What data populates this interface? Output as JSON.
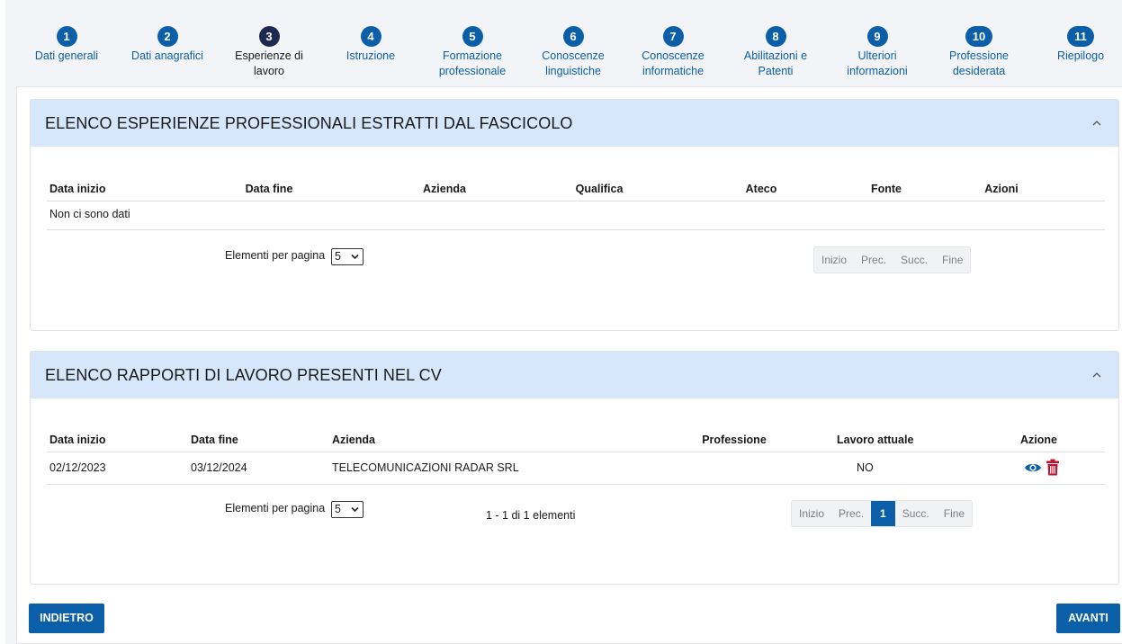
{
  "stepper": {
    "steps": [
      {
        "num": "1",
        "label": "Dati generali"
      },
      {
        "num": "2",
        "label": "Dati anagrafici"
      },
      {
        "num": "3",
        "label": "Esperienze di lavoro"
      },
      {
        "num": "4",
        "label": "Istruzione"
      },
      {
        "num": "5",
        "label": "Formazione professionale"
      },
      {
        "num": "6",
        "label": "Conoscenze linguistiche"
      },
      {
        "num": "7",
        "label": "Conoscenze informatiche"
      },
      {
        "num": "8",
        "label": "Abilitazioni e Patenti"
      },
      {
        "num": "9",
        "label": "Ulteriori informazioni"
      },
      {
        "num": "10",
        "label": "Professione desiderata"
      },
      {
        "num": "11",
        "label": "Riepilogo"
      }
    ],
    "active_step": "3"
  },
  "panel_fascicolo": {
    "title": "ELENCO ESPERIENZE PROFESSIONALI ESTRATTI DAL FASCICOLO",
    "columns": [
      "Data inizio",
      "Data fine",
      "Azienda",
      "Qualifica",
      "Ateco",
      "Fonte",
      "Azioni"
    ],
    "empty_text": "Non ci sono dati",
    "per_page_label": "Elementi per pagina",
    "per_page_value": "5",
    "pager": {
      "first": "Inizio",
      "prev": "Prec.",
      "next": "Succ.",
      "last": "Fine"
    }
  },
  "panel_cv": {
    "title": "ELENCO RAPPORTI DI LAVORO PRESENTI NEL CV",
    "columns": [
      "Data inizio",
      "Data fine",
      "Azienda",
      "Professione",
      "Lavoro attuale",
      "Azione"
    ],
    "rows": [
      {
        "data_inizio": "02/12/2023",
        "data_fine": "03/12/2024",
        "azienda": "TELECOMUNICAZIONI RADAR SRL",
        "professione": "",
        "lavoro_attuale": "NO"
      }
    ],
    "row_icons": [
      "eye-icon",
      "trash-icon"
    ],
    "per_page_label": "Elementi per pagina",
    "per_page_value": "5",
    "count_text": "1 - 1 di 1 elementi",
    "pager": {
      "first": "Inizio",
      "prev": "Prec.",
      "current": "1",
      "next": "Succ.",
      "last": "Fine"
    }
  },
  "footer": {
    "back_label": "INDIETRO",
    "next_label": "AVANTI"
  },
  "colors": {
    "primary": "#0b5fa8",
    "active_step": "#1b2b4f",
    "panel_header": "#d6e6fb",
    "delete": "#c8102e"
  }
}
